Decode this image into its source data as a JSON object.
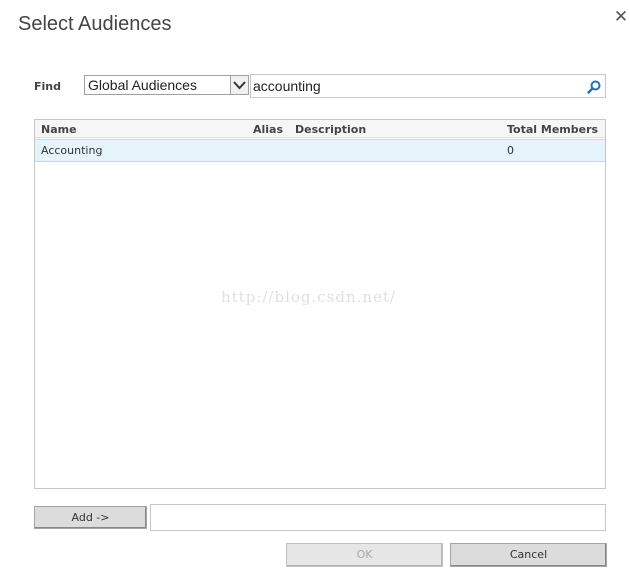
{
  "dialog": {
    "title": "Select Audiences",
    "close_symbol": "✕"
  },
  "find": {
    "label": "Find",
    "scope_value": "Global Audiences",
    "search_value": "accounting"
  },
  "results": {
    "columns": {
      "name": "Name",
      "alias": "Alias",
      "description": "Description",
      "total_members": "Total Members"
    },
    "rows": [
      {
        "name": "Accounting",
        "alias": "",
        "description": "",
        "total_members": "0"
      }
    ]
  },
  "watermark": "http://blog.csdn.net/",
  "actions": {
    "add_label": "Add ->",
    "selected_value": "",
    "ok_label": "OK",
    "cancel_label": "Cancel"
  },
  "colors": {
    "selected_row_bg": "#e5f4fb",
    "selected_row_border": "#b6e1f2",
    "search_icon": "#2a6fb0"
  },
  "icons": {
    "close": "close-icon",
    "dropdown": "chevron-down-icon",
    "search": "search-icon"
  }
}
